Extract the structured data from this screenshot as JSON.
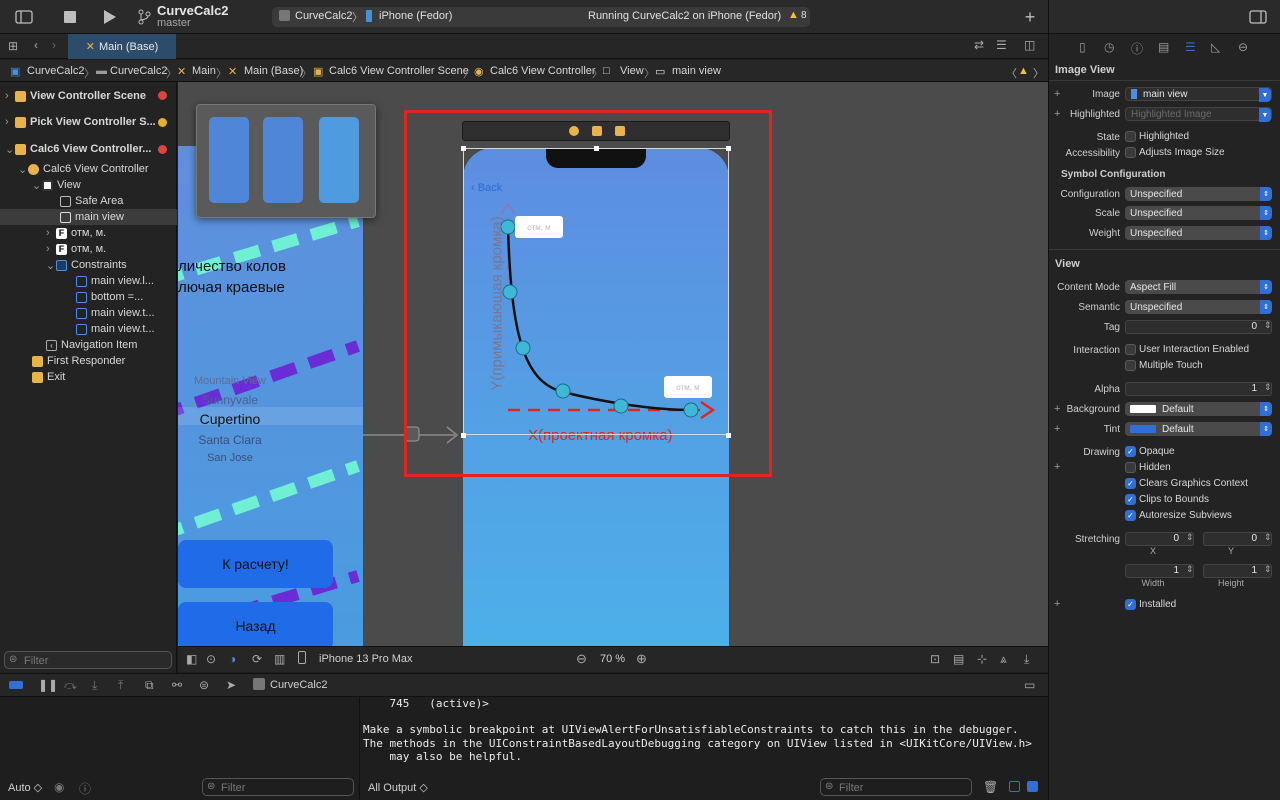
{
  "toolbar": {
    "project_name": "CurveCalc2",
    "branch": "master",
    "scheme_target": "CurveCalc2",
    "scheme_device": "iPhone (Fedor)",
    "run_status": "Running CurveCalc2 on iPhone (Fedor)",
    "warning_count": "8"
  },
  "tab": {
    "label": "Main (Base)"
  },
  "breadcrumb": [
    "CurveCalc2",
    "CurveCalc2",
    "Main",
    "Main (Base)",
    "Calc6 View Controller Scene",
    "Calc6 View Controller",
    "View",
    "main view"
  ],
  "navigator": {
    "items": [
      {
        "label": "View Controller Scene",
        "bold": true
      },
      {
        "label": "Pick View Controller S...",
        "bold": true
      },
      {
        "label": "Calc6 View Controller...",
        "bold": true
      },
      {
        "label": "Calc6 View Controller"
      },
      {
        "label": "View"
      },
      {
        "label": "Safe Area"
      },
      {
        "label": "main view"
      },
      {
        "label": "отм, м."
      },
      {
        "label": "отм, м."
      },
      {
        "label": "Constraints"
      },
      {
        "label": "main view.l..."
      },
      {
        "label": "bottom =..."
      },
      {
        "label": "main view.t..."
      },
      {
        "label": "main view.t..."
      },
      {
        "label": "Navigation Item"
      },
      {
        "label": "First Responder"
      },
      {
        "label": "Exit"
      }
    ],
    "filter_placeholder": "Filter"
  },
  "canvas": {
    "left_screen": {
      "text_line1": "личество колов",
      "text_line2": "лючая краевые",
      "picker": [
        "Mountain View",
        "Sunnyvale",
        "Cupertino",
        "Santa Clara",
        "San Jose"
      ],
      "button_calc": "К расчету!",
      "button_back": "Назад"
    },
    "phone": {
      "back_label": "Back",
      "label_top": "отм, м",
      "label_right": "отм, м",
      "y_axis_label": "Y(примыкающая кромка)",
      "x_axis_label": "X(проектная кромка)"
    },
    "bottom_bar": {
      "device": "iPhone 13 Pro Max",
      "zoom": "70 %"
    }
  },
  "debug": {
    "target": "CurveCalc2",
    "vars_mode": "Auto ◇",
    "vars_filter_placeholder": "Filter",
    "output_mode": "All Output ◇",
    "console_filter_placeholder": "Filter",
    "console_lines": [
      "    745   (active)>",
      "",
      "Make a symbolic breakpoint at UIViewAlertForUnsatisfiableConstraints to catch this in the debugger.",
      "The methods in the UIConstraintBasedLayoutDebugging category on UIView listed in <UIKitCore/UIView.h>",
      "    may also be helpful."
    ]
  },
  "inspector": {
    "image_view_title": "Image View",
    "image_label": "Image",
    "image_value": "main view",
    "highlighted_label": "Highlighted",
    "highlighted_placeholder": "Highlighted Image",
    "state_label": "State",
    "state_check": "Highlighted",
    "accessibility_label": "Accessibility",
    "accessibility_check": "Adjusts Image Size",
    "symbol_title": "Symbol Configuration",
    "configuration_label": "Configuration",
    "configuration_value": "Unspecified",
    "scale_label": "Scale",
    "scale_value": "Unspecified",
    "weight_label": "Weight",
    "weight_value": "Unspecified",
    "view_title": "View",
    "content_mode_label": "Content Mode",
    "content_mode_value": "Aspect Fill",
    "semantic_label": "Semantic",
    "semantic_value": "Unspecified",
    "tag_label": "Tag",
    "tag_value": "0",
    "interaction_label": "Interaction",
    "interaction_check1": "User Interaction Enabled",
    "interaction_check2": "Multiple Touch",
    "alpha_label": "Alpha",
    "alpha_value": "1",
    "background_label": "Background",
    "background_value": "Default",
    "tint_label": "Tint",
    "tint_value": "Default",
    "drawing_label": "Drawing",
    "drawing_checks": [
      "Opaque",
      "Hidden",
      "Clears Graphics Context",
      "Clips to Bounds",
      "Autoresize Subviews"
    ],
    "stretching_label": "Stretching",
    "stretch_x": "0",
    "stretch_y": "0",
    "stretch_w": "1",
    "stretch_h": "1",
    "x_label": "X",
    "y_label": "Y",
    "width_label": "Width",
    "height_label": "Height",
    "installed_label": "Installed"
  },
  "colors": {
    "accent": "#2f6fd6",
    "selection_red": "#e0261c",
    "curve_node": "#3fb8d6"
  }
}
